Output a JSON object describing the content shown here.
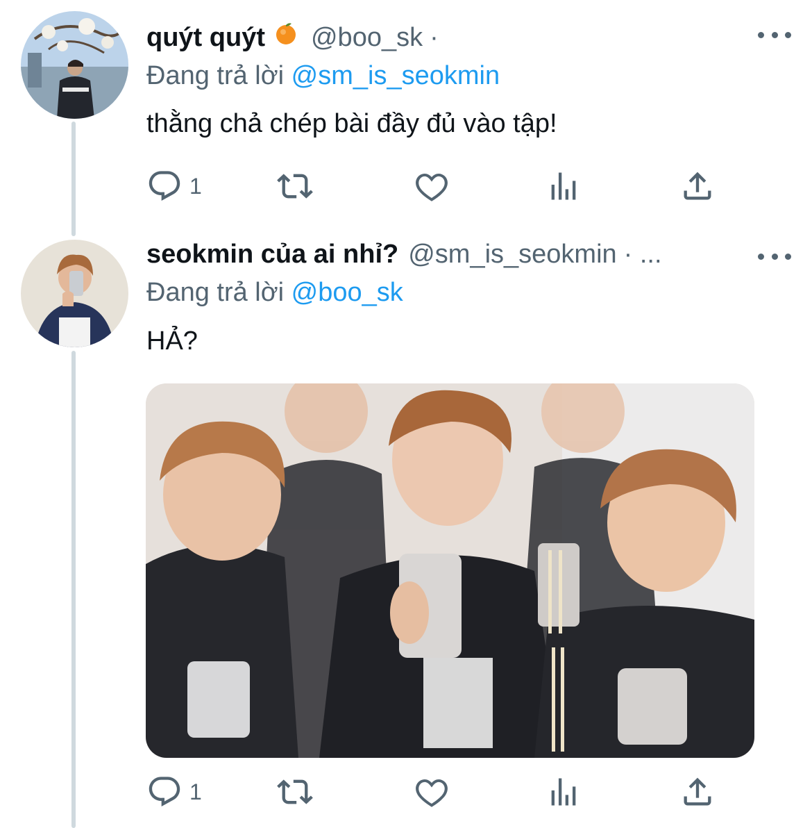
{
  "tweets": [
    {
      "display_name": "quýt quýt",
      "emoji": "🍊",
      "handle": "@boo_sk",
      "separator": "·",
      "reply_prefix": "Đang trả lời",
      "reply_mention": "@sm_is_seokmin",
      "text": "thằng chả chép bài đầy đủ vào tập!",
      "reply_count": "1"
    },
    {
      "display_name": "seokmin của ai nhỉ?",
      "handle": "@sm_is_seokmin",
      "separator": "· ...",
      "reply_prefix": "Đang trả lời",
      "reply_mention": "@boo_sk",
      "text": "HẢ?",
      "reply_count": "1"
    }
  ],
  "colors": {
    "text_primary": "#0f1419",
    "text_secondary": "#536471",
    "link": "#1d9bf0",
    "thread_line": "#cfd9de"
  },
  "icons": [
    "reply-icon",
    "retweet-icon",
    "like-icon",
    "views-icon",
    "share-icon",
    "more-icon"
  ]
}
